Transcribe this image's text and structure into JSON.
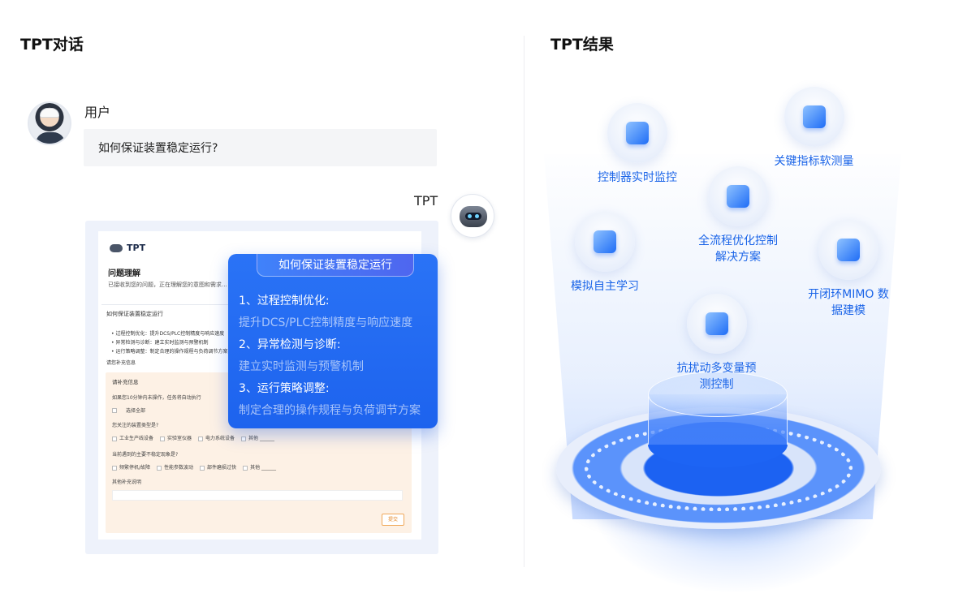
{
  "left": {
    "title": "TPT对话",
    "user": {
      "name": "用户",
      "message": "如何保证装置稳定运行?"
    },
    "assistant": {
      "name": "TPT"
    },
    "doc": {
      "logo": "TPT",
      "section_title": "问题理解",
      "section_sub": "已接收到您的问题，正在理解您的意图和需求...",
      "box_heading": "如何保证装置稳定运行",
      "bullets": [
        "• 过程控制优化：提升DCS/PLC控制精度与响应速度",
        "• 异常检测与诊断：建立实时监测与预警机制",
        "• 运行策略调整：制定合理的操作规程与负荷调节方案"
      ],
      "more_label": "请您补充信息",
      "form": {
        "title": "请补充信息",
        "timeout_note": "如果您10分钟内未操作，任务将自动执行",
        "select_all": "选择全部",
        "q1": "您关注的装置类型是?",
        "q1_options": [
          "工业生产线设备",
          "实验室仪器",
          "电力系统设备",
          "其他 ______"
        ],
        "q2": "当前遇到的主要不稳定现象是?",
        "q2_options": [
          "频繁停机/故障",
          "性能参数波动",
          "部件磨损过快",
          "其他 ______"
        ],
        "q3": "其他补充说明",
        "submit": "提交"
      }
    },
    "popup": {
      "title": "如何保证装置稳定运行",
      "items": [
        {
          "heading": "1、过程控制优化:",
          "detail": "提升DCS/PLC控制精度与响应速度"
        },
        {
          "heading": "2、异常检测与诊断:",
          "detail": "建立实时监测与预警机制"
        },
        {
          "heading": "3、运行策略调整:",
          "detail": "制定合理的操作规程与负荷调节方案"
        }
      ]
    }
  },
  "right": {
    "title": "TPT结果",
    "nodes": [
      {
        "label": "控制器实时监控",
        "icon": "monitor-upload-icon"
      },
      {
        "label": "关键指标软测量",
        "icon": "dashboard-icon"
      },
      {
        "label": "全流程优化控制\n解决方案",
        "icon": "presentation-icon"
      },
      {
        "label": "模拟自主学习",
        "icon": "cube-icon"
      },
      {
        "label": "开闭环MIMO 数\n据建模",
        "icon": "chart-scatter-icon"
      },
      {
        "label": "抗扰动多变量预\n测控制",
        "icon": "trend-chart-icon"
      }
    ],
    "accent_color": "#1a64e8"
  }
}
